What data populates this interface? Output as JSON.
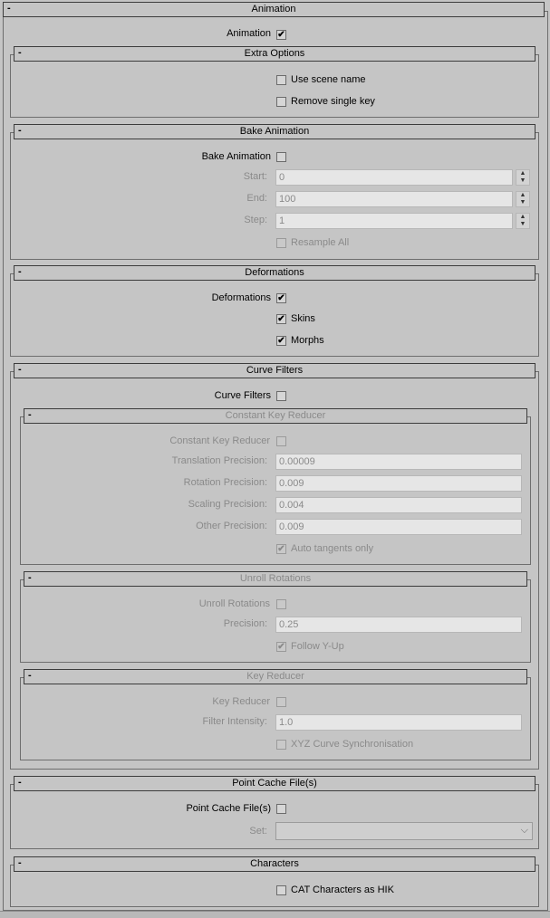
{
  "animation": {
    "title": "Animation",
    "toggle": "-",
    "label": "Animation",
    "checked": true
  },
  "extra_options": {
    "title": "Extra Options",
    "toggle": "-",
    "use_scene_name": "Use scene name",
    "remove_single_key": "Remove single key"
  },
  "bake_animation": {
    "title": "Bake Animation",
    "toggle": "-",
    "label": "Bake Animation",
    "start_label": "Start:",
    "start_value": "0",
    "end_label": "End:",
    "end_value": "100",
    "step_label": "Step:",
    "step_value": "1",
    "resample_all": "Resample All"
  },
  "deformations": {
    "title": "Deformations",
    "toggle": "-",
    "label": "Deformations",
    "skins": "Skins",
    "morphs": "Morphs"
  },
  "curve_filters": {
    "title": "Curve Filters",
    "toggle": "-",
    "label": "Curve Filters",
    "constant_key_reducer": {
      "title": "Constant Key Reducer",
      "toggle": "-",
      "label": "Constant Key Reducer",
      "translation_label": "Translation Precision:",
      "translation_value": "0.00009",
      "rotation_label": "Rotation Precision:",
      "rotation_value": "0.009",
      "scaling_label": "Scaling Precision:",
      "scaling_value": "0.004",
      "other_label": "Other Precision:",
      "other_value": "0.009",
      "auto_tangents": "Auto tangents only"
    },
    "unroll_rotations": {
      "title": "Unroll Rotations",
      "toggle": "-",
      "label": "Unroll Rotations",
      "precision_label": "Precision:",
      "precision_value": "0.25",
      "follow_y_up": "Follow Y-Up"
    },
    "key_reducer": {
      "title": "Key Reducer",
      "toggle": "-",
      "label": "Key Reducer",
      "filter_intensity_label": "Filter Intensity:",
      "filter_intensity_value": "1.0",
      "xyz_sync": "XYZ Curve Synchronisation"
    }
  },
  "point_cache": {
    "title": "Point Cache File(s)",
    "toggle": "-",
    "label": "Point Cache File(s)",
    "set_label": "Set:",
    "set_value": ""
  },
  "characters": {
    "title": "Characters",
    "toggle": "-",
    "cat_as_hik": "CAT Characters as HIK"
  },
  "icons": {
    "check": "✔",
    "spin_up": "▲",
    "spin_down": "▼",
    "dropdown": "⌵"
  }
}
